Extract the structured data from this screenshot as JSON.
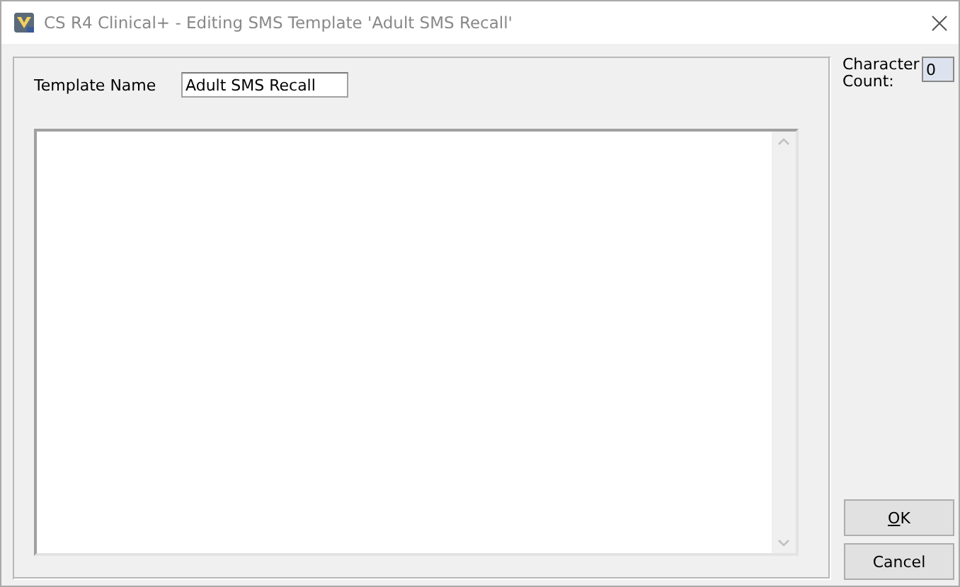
{
  "window": {
    "title": "CS R4 Clinical+ - Editing SMS Template 'Adult SMS Recall'"
  },
  "template_name": {
    "label": "Template Name",
    "value": "Adult SMS Recall"
  },
  "character_count": {
    "label": "Character Count:",
    "value": "0"
  },
  "buttons": [
    {
      "label": "OK",
      "mnemonic": true
    },
    {
      "label": "Cancel",
      "mnemonic": false
    }
  ]
}
